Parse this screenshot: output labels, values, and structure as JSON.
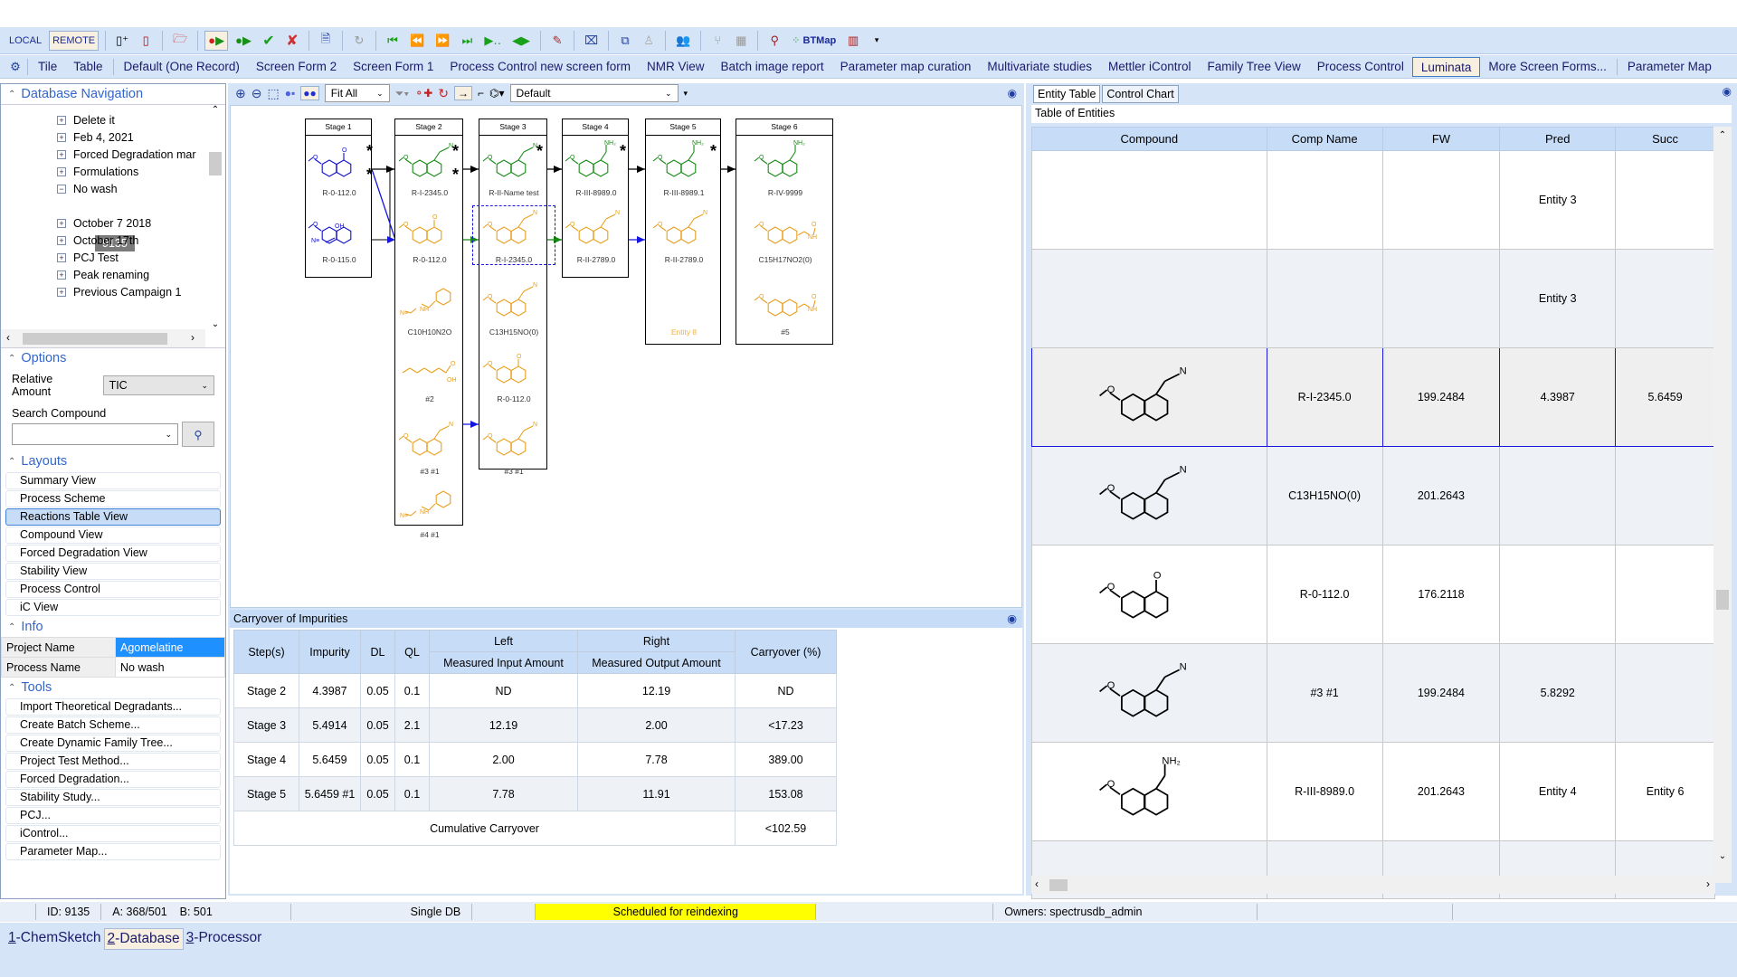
{
  "toolbar": {
    "local_label": "LOCAL",
    "remote_label": "REMOTE",
    "btmap_label": "BTMap"
  },
  "forms": {
    "items": [
      "Tile",
      "Table",
      "Default (One Record)",
      "Screen Form 2",
      "Screen Form 1",
      "Process Control new screen form",
      "NMR View",
      "Batch image report",
      "Parameter map curation",
      "Multivariate studies",
      "Mettler iControl",
      "Family Tree View",
      "Process Control",
      "Luminata",
      "More Screen Forms...",
      "Parameter Map"
    ],
    "active": "Luminata"
  },
  "left": {
    "db_nav_title": "Database Navigation",
    "tree": [
      {
        "label": "Delete it",
        "state": "collapsed"
      },
      {
        "label": "Feb 4, 2021",
        "state": "collapsed"
      },
      {
        "label": "Forced Degradation mar",
        "state": "collapsed"
      },
      {
        "label": "Formulations",
        "state": "collapsed"
      },
      {
        "label": "No wash",
        "state": "expanded"
      },
      {
        "label": "October 7 2018",
        "state": "collapsed"
      },
      {
        "label": "October 17th",
        "state": "collapsed"
      },
      {
        "label": "PCJ Test",
        "state": "collapsed"
      },
      {
        "label": "Peak renaming",
        "state": "collapsed"
      },
      {
        "label": "Previous Campaign 1",
        "state": "collapsed"
      }
    ],
    "selected_record": "9135",
    "options_title": "Options",
    "relative_amount_label": "Relative Amount",
    "relative_amount_value": "TIC",
    "search_compound_label": "Search Compound",
    "search_compound_value": "",
    "layouts_title": "Layouts",
    "layouts": [
      "Summary View",
      "Process Scheme",
      "Reactions Table View",
      "Compound View",
      "Forced Degradation View",
      "Stability View",
      "Process Control",
      "iC View"
    ],
    "active_layout": "Reactions Table View",
    "info_title": "Info",
    "info": [
      {
        "key": "Project Name",
        "value": "Agomelatine"
      },
      {
        "key": "Process Name",
        "value": "No wash"
      }
    ],
    "tools_title": "Tools",
    "tools": [
      "Import Theoretical Degradants...",
      "Create Batch Scheme...",
      "Create Dynamic Family Tree...",
      "Project Test Method...",
      "Forced Degradation...",
      "Stability Study...",
      "PCJ...",
      "iControl...",
      "Parameter Map..."
    ]
  },
  "center": {
    "zoom_mode": "Fit All",
    "style_select": "Default",
    "stages": [
      {
        "title": "Stage 1",
        "compounds": [
          {
            "label": "R-0-112.0",
            "color": "#1010d0"
          },
          {
            "label": "R-0-115.0",
            "color": "#1010d0"
          }
        ]
      },
      {
        "title": "Stage 2",
        "compounds": [
          {
            "label": "R-I-2345.0",
            "color": "#188a18"
          },
          {
            "label": "R-0-112.0",
            "color": "#e8a020"
          },
          {
            "label": "C10H10N2O",
            "color": "#e8a020"
          },
          {
            "label": "#2",
            "color": "#e8a020"
          },
          {
            "label": "#3 #1",
            "color": "#e8a020"
          },
          {
            "label": "#4 #1",
            "color": "#e8a020"
          }
        ]
      },
      {
        "title": "Stage 3",
        "compounds": [
          {
            "label": "R-II-Name test",
            "color": "#188a18"
          },
          {
            "label": "R-I-2345.0",
            "color": "#e8a020"
          },
          {
            "label": "C13H15NO(0)",
            "color": "#e8a020"
          },
          {
            "label": "R-0-112.0",
            "color": "#e8a020"
          },
          {
            "label": "#3 #1",
            "color": "#e8a020"
          }
        ]
      },
      {
        "title": "Stage 4",
        "compounds": [
          {
            "label": "R-III-8989.0",
            "color": "#188a18"
          },
          {
            "label": "R-II-2789.0",
            "color": "#e8a020"
          }
        ]
      },
      {
        "title": "Stage 5",
        "compounds": [
          {
            "label": "R-III-8989.1",
            "color": "#188a18"
          },
          {
            "label": "R-II-2789.0",
            "color": "#e8a020"
          },
          {
            "label": "Entity 8",
            "color": "#f0b040"
          }
        ]
      },
      {
        "title": "Stage 6",
        "compounds": [
          {
            "label": "R-IV-9999",
            "color": "#188a18"
          },
          {
            "label": "C15H17NO2(0)",
            "color": "#e8a020"
          },
          {
            "label": "#5",
            "color": "#e8a020"
          }
        ]
      }
    ],
    "carryover": {
      "title": "Carryover of Impurities",
      "headers": {
        "steps": "Step(s)",
        "impurity": "Impurity",
        "dl": "DL",
        "ql": "QL",
        "left": "Left",
        "left_sub": "Measured Input Amount",
        "right": "Right",
        "right_sub": "Measured Output Amount",
        "carryover": "Carryover (%)"
      },
      "rows": [
        {
          "step": "Stage 2",
          "impurity": "4.3987",
          "dl": "0.05",
          "ql": "0.1",
          "input": "ND",
          "output": "12.19",
          "carryover": "ND"
        },
        {
          "step": "Stage 3",
          "impurity": "5.4914",
          "dl": "0.05",
          "ql": "2.1",
          "input": "12.19",
          "output": "2.00",
          "carryover": "<17.23"
        },
        {
          "step": "Stage 4",
          "impurity": "5.6459",
          "dl": "0.05",
          "ql": "0.1",
          "input": "2.00",
          "output": "7.78",
          "carryover": "389.00"
        },
        {
          "step": "Stage 5",
          "impurity": "5.6459 #1",
          "dl": "0.05",
          "ql": "0.1",
          "input": "7.78",
          "output": "11.91",
          "carryover": "153.08"
        }
      ],
      "cumulative_label": "Cumulative Carryover",
      "cumulative_value": "<102.59"
    }
  },
  "right": {
    "tabs": [
      "Entity Table",
      "Control Chart"
    ],
    "active_tab": "Entity Table",
    "table_title": "Table of Entities",
    "columns": [
      "Compound",
      "Comp Name",
      "FW",
      "Pred",
      "Succ"
    ],
    "rows": [
      {
        "structure": "",
        "name": "",
        "fw": "",
        "pred": "Entity 3",
        "succ": ""
      },
      {
        "structure": "",
        "name": "",
        "fw": "",
        "pred": "Entity 3",
        "succ": ""
      },
      {
        "structure": "dihydronaphthyl-acetonitrile",
        "name": "R-I-2345.0",
        "fw": "199.2484",
        "pred": "4.3987",
        "succ": "5.6459"
      },
      {
        "structure": "tetralinyl-acetonitrile",
        "name": "C13H15NO(0)",
        "fw": "201.2643",
        "pred": "",
        "succ": ""
      },
      {
        "structure": "methoxy-tetralone",
        "name": "R-0-112.0",
        "fw": "176.2118",
        "pred": "",
        "succ": ""
      },
      {
        "structure": "tetralinylidene-acetonitrile",
        "name": "#3 #1",
        "fw": "199.2484",
        "pred": "5.8292",
        "succ": ""
      },
      {
        "structure": "naphthyl-ethylamine",
        "name": "R-III-8989.0",
        "fw": "201.2643",
        "pred": "Entity 4",
        "succ": "Entity 6"
      },
      {
        "structure": "",
        "name": "",
        "fw": "",
        "pred": "",
        "succ": ""
      }
    ],
    "selected_row": 2
  },
  "status": {
    "id": "ID: 9135",
    "a": "A: 368/501",
    "b": "B: 501",
    "db_mode": "Single DB",
    "reindex": "Scheduled for reindexing",
    "owners": "Owners: spectrusdb_admin"
  },
  "bottom_tabs": [
    {
      "key": "1",
      "label": "-ChemSketch"
    },
    {
      "key": "2",
      "label": "-Database"
    },
    {
      "key": "3",
      "label": "-Processor"
    }
  ],
  "active_bottom_tab": 1
}
